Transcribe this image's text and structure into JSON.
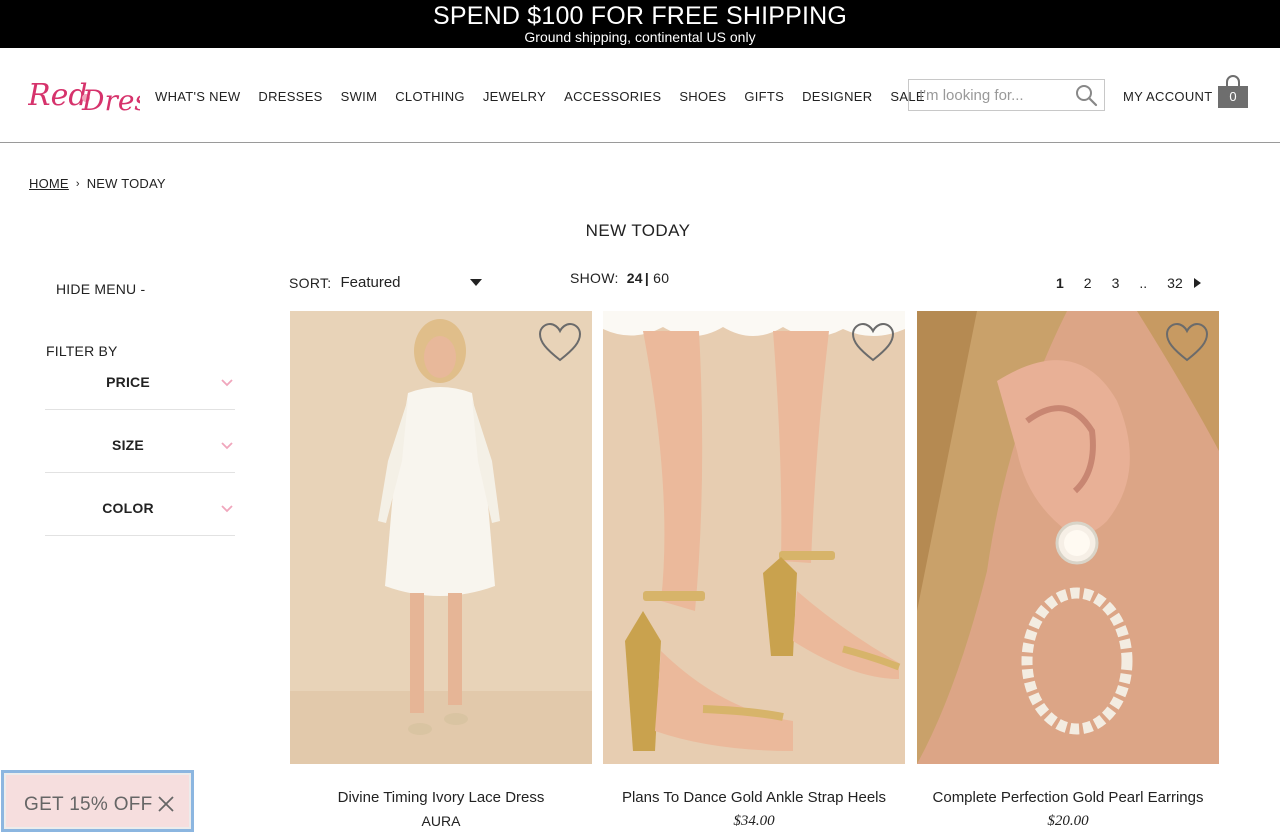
{
  "promo_bar": {
    "headline": "SPEND $100 FOR FREE SHIPPING",
    "subline": "Ground shipping, continental US only"
  },
  "header": {
    "logo_text": "Red Dress",
    "nav": [
      "WHAT'S NEW",
      "DRESSES",
      "SWIM",
      "CLOTHING",
      "JEWELRY",
      "ACCESSORIES",
      "SHOES",
      "GIFTS",
      "DESIGNER",
      "SALE"
    ],
    "search_placeholder": "I'm looking for...",
    "account_label": "MY ACCOUNT",
    "bag_count": "0"
  },
  "breadcrumb": {
    "home": "HOME",
    "separator": "›",
    "current": "NEW TODAY"
  },
  "page_title": "NEW TODAY",
  "sidebar": {
    "hide_menu": "HIDE MENU -",
    "filter_by": "FILTER BY",
    "filters": [
      "PRICE",
      "SIZE",
      "COLOR"
    ]
  },
  "toolbar": {
    "sort_label": "SORT:",
    "sort_value": "Featured",
    "show_label": "SHOW:",
    "show_options": [
      "24",
      "60"
    ],
    "show_separator": "|",
    "pages": [
      "1",
      "2",
      "3",
      "..",
      "32"
    ]
  },
  "products": [
    {
      "name": "Divine Timing Ivory Lace Dress",
      "meta": "AURA",
      "image": "ivory-lace-dress-photo"
    },
    {
      "name": "Plans To Dance Gold Ankle Strap Heels",
      "meta": "$34.00",
      "image": "gold-heels-photo"
    },
    {
      "name": "Complete Perfection Gold Pearl Earrings",
      "meta": "$20.00",
      "image": "pearl-earrings-photo"
    }
  ],
  "discount_popup": {
    "label": "GET 15% OFF"
  },
  "colors": {
    "logo_pink": "#d6336c",
    "chevron_pink": "#f0a6bc",
    "promo_bg": "#000000",
    "popup_bg": "#f6dede",
    "popup_border": "#8cb6e0"
  }
}
